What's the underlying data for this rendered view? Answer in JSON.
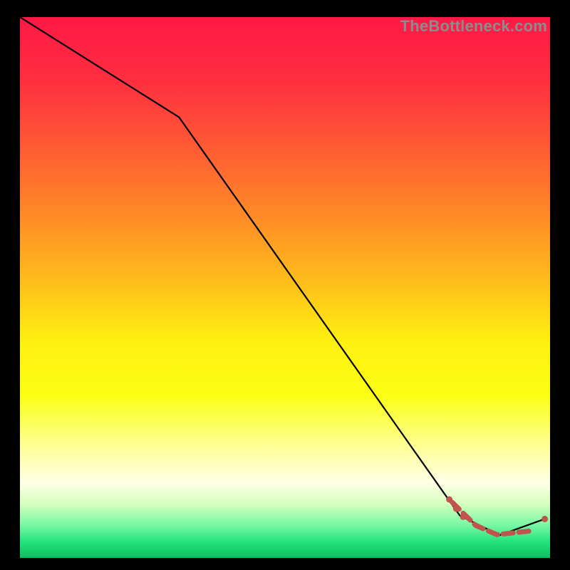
{
  "watermark": "TheBottleneck.com",
  "chart_data": {
    "type": "line",
    "title": "",
    "xlabel": "",
    "ylabel": "",
    "xlim": [
      0,
      100
    ],
    "ylim": [
      0,
      100
    ],
    "background_gradient": {
      "stops": [
        {
          "y": 0,
          "color": "#ff1846"
        },
        {
          "y": 12,
          "color": "#ff2f3f"
        },
        {
          "y": 25,
          "color": "#ff5e33"
        },
        {
          "y": 38,
          "color": "#ff8f26"
        },
        {
          "y": 50,
          "color": "#ffc21a"
        },
        {
          "y": 60,
          "color": "#fff010"
        },
        {
          "y": 70,
          "color": "#fbff14"
        },
        {
          "y": 80,
          "color": "#ffff9e"
        },
        {
          "y": 86,
          "color": "#ffffe6"
        },
        {
          "y": 90,
          "color": "#d6ffbe"
        },
        {
          "y": 94,
          "color": "#76f7a3"
        },
        {
          "y": 97,
          "color": "#24e37e"
        },
        {
          "y": 100,
          "color": "#0bbf5f"
        }
      ]
    },
    "series": [
      {
        "name": "main-line",
        "color": "#000000",
        "x": [
          0,
          30.0,
          83.0,
          90.5,
          99.0
        ],
        "values": [
          100,
          81.5,
          7.8,
          4.2,
          7.2
        ]
      }
    ],
    "paths": [
      {
        "name": "dashed-segment",
        "color": "#c1544d",
        "stroke_width": 7,
        "dash": "14 8",
        "x": [
          81.5,
          86.0,
          90.0,
          96.5
        ],
        "values": [
          10.3,
          6.0,
          4.3,
          5.0
        ]
      }
    ],
    "points": [
      {
        "x": 81.0,
        "y": 10.8,
        "r": 4.5,
        "color": "#c1544d"
      },
      {
        "x": 82.3,
        "y": 9.1,
        "r": 4.5,
        "color": "#c1544d"
      },
      {
        "x": 83.6,
        "y": 7.6,
        "r": 4.5,
        "color": "#c1544d"
      },
      {
        "x": 99.0,
        "y": 7.2,
        "r": 4.5,
        "color": "#c1544d"
      }
    ]
  }
}
